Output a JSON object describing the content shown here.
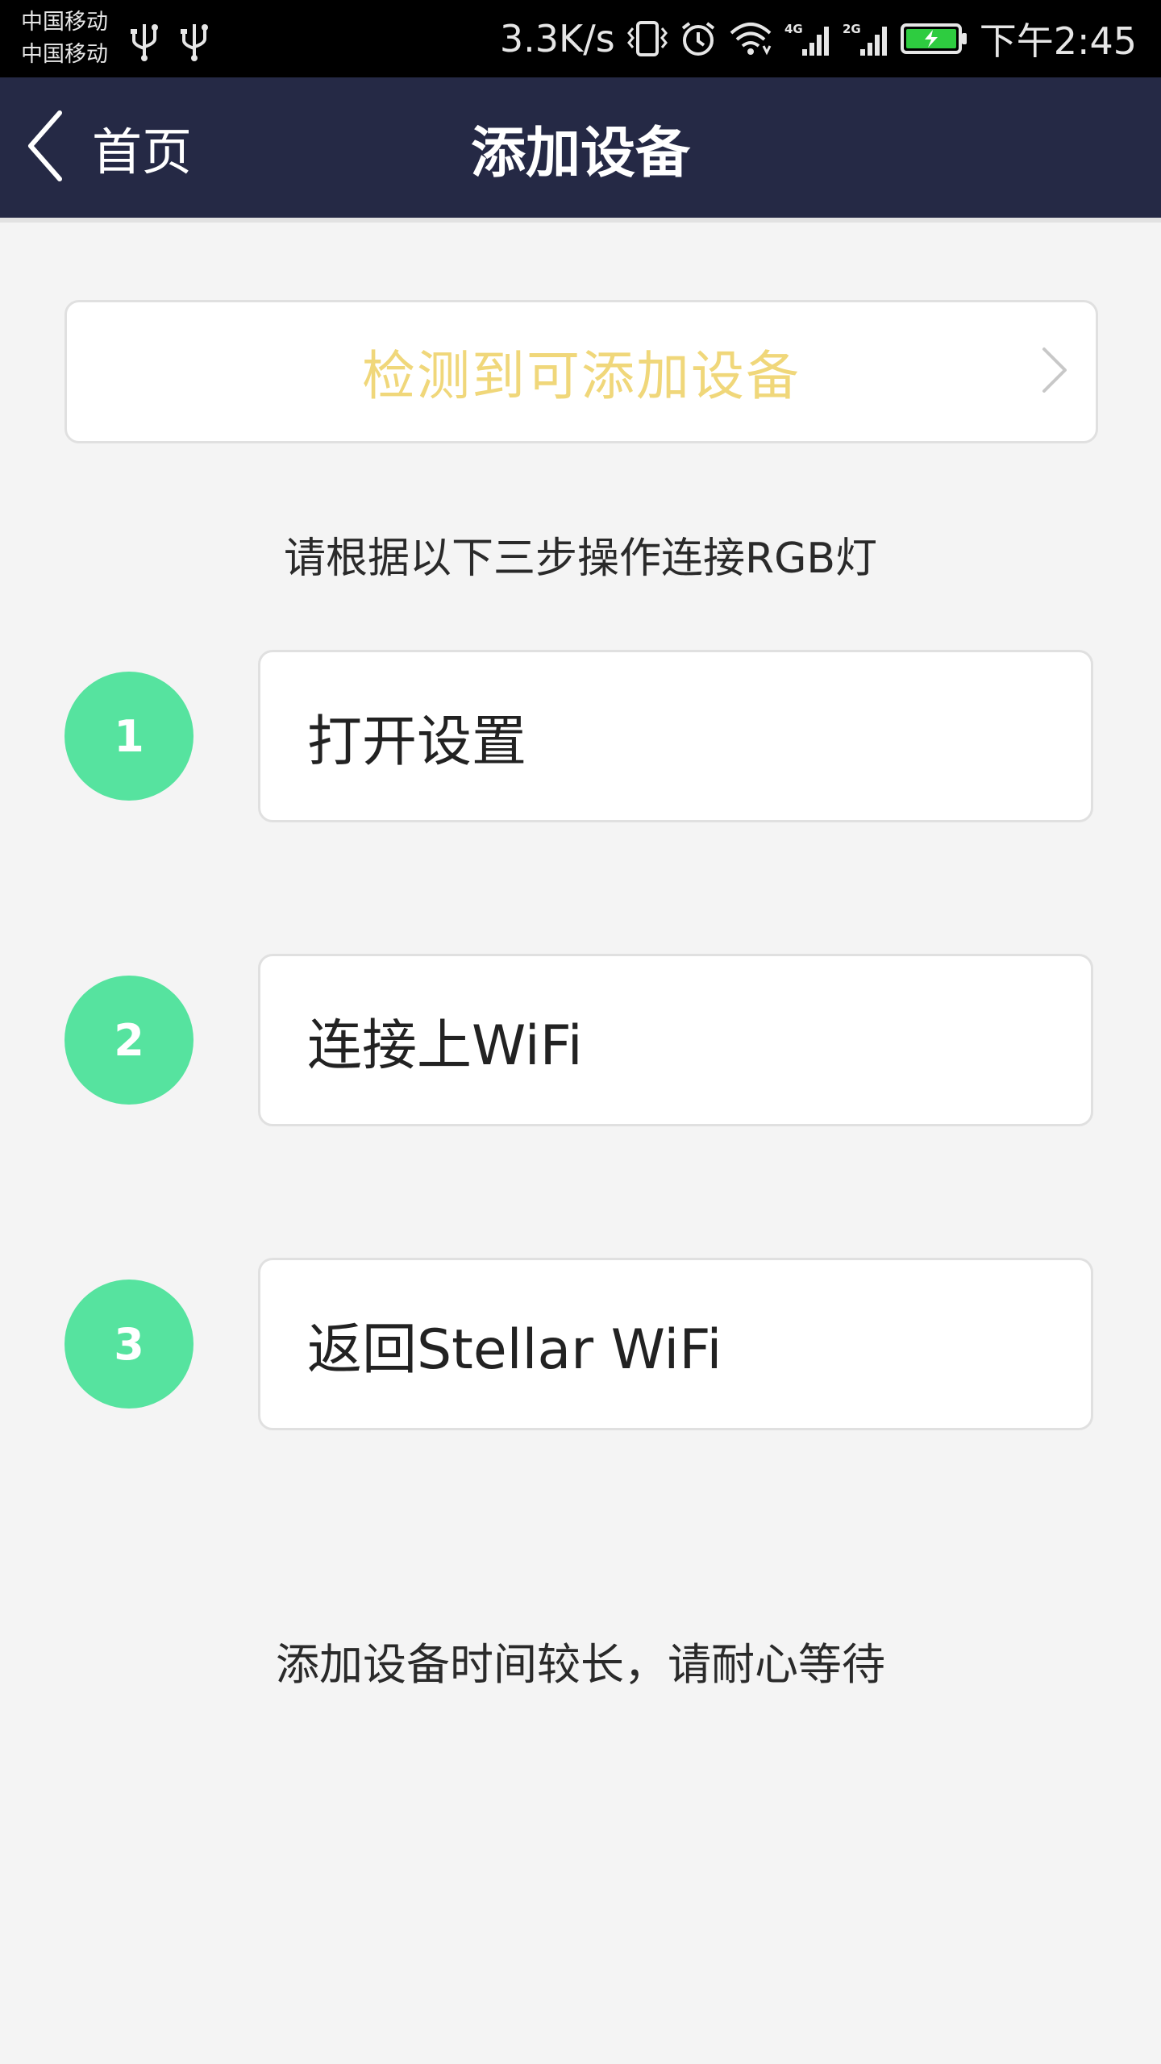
{
  "status_bar": {
    "carrier_1": "中国移动",
    "carrier_2": "中国移动",
    "net_speed": "3.3K/s",
    "sim1_network": "4G",
    "sim2_network": "2G",
    "time": "下午2:45",
    "icons": [
      "usb-icon",
      "usb-icon",
      "vibrate-icon",
      "alarm-icon",
      "wifi-icon",
      "signal-icon",
      "signal-icon",
      "battery-charging-icon"
    ],
    "battery_color": "#2ecc40"
  },
  "header": {
    "back_label": "首页",
    "title": "添加设备",
    "background": "#252945"
  },
  "detect_banner": {
    "label": "检测到可添加设备",
    "color": "#f0d77a"
  },
  "instruction": "请根据以下三步操作连接RGB灯",
  "steps": [
    {
      "number": "1",
      "label": "打开设置"
    },
    {
      "number": "2",
      "label": "连接上WiFi"
    },
    {
      "number": "3",
      "label": "返回Stellar WiFi"
    }
  ],
  "step_accent": "#56e39f",
  "wait_note": "添加设备时间较长，请耐心等待"
}
